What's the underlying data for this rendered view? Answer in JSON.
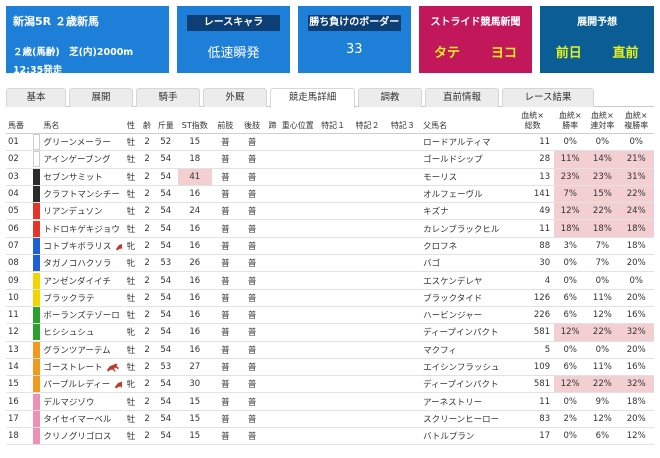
{
  "race": {
    "name": "新潟5R ２歳新馬",
    "cond": "２歳(馬齢)　芝(内)2000m",
    "time": "12:35発走"
  },
  "cards": {
    "chara": {
      "label": "レースキャラ",
      "value": "低速瞬発"
    },
    "border": {
      "label": "勝ち負けのボーダー",
      "value": "33"
    },
    "news": {
      "label": "ストライド競馬新聞",
      "left": "タテ",
      "right": "ヨコ"
    },
    "forecast": {
      "label": "展開予想",
      "left": "前日",
      "right": "直前"
    }
  },
  "tabs": [
    "基本",
    "展開",
    "騎手",
    "外厩",
    "競走馬詳細",
    "調教",
    "直前情報",
    "レース結果"
  ],
  "active_tab": 4,
  "columns": {
    "num": "馬番",
    "name": "馬名",
    "sex": "性",
    "age": "齢",
    "weight": "斤量",
    "st": "ST指数",
    "front": "前肢",
    "rear": "後肢",
    "hoof": "蹄",
    "center": "重心位置",
    "note1": "特記１",
    "note2": "特記２",
    "note3": "特記３",
    "sire": "父馬名",
    "runs": "血統×\n総数",
    "win": "血統×\n勝率",
    "quin": "血統×\n連対率",
    "show": "血統×\n複勝率"
  },
  "gate_colors": [
    "#ffffff",
    "#2b2b2b",
    "#e8332a",
    "#1f5fd6",
    "#f2d400",
    "#2ba12b",
    "#f39a1e",
    "#f08fb6"
  ],
  "rows": [
    {
      "num": "01",
      "gate": 0,
      "name": "グリーンメーラー",
      "mark": false,
      "sex": "牡",
      "age": "2",
      "weight": "52",
      "st": "15",
      "st_hl": false,
      "front": "普",
      "rear": "普",
      "sire": "ロードアルティマ",
      "runs": "11",
      "win": "0%",
      "quin": "0%",
      "show": "0%",
      "rate_hl": false
    },
    {
      "num": "02",
      "gate": 0,
      "name": "アインゲーブング",
      "mark": false,
      "sex": "牡",
      "age": "2",
      "weight": "54",
      "st": "18",
      "st_hl": false,
      "front": "普",
      "rear": "普",
      "sire": "ゴールドシップ",
      "runs": "28",
      "win": "11%",
      "quin": "14%",
      "show": "21%",
      "rate_hl": true
    },
    {
      "num": "03",
      "gate": 1,
      "name": "セブンサミット",
      "mark": false,
      "sex": "牡",
      "age": "2",
      "weight": "54",
      "st": "41",
      "st_hl": true,
      "front": "普",
      "rear": "普",
      "sire": "モーリス",
      "runs": "13",
      "win": "23%",
      "quin": "23%",
      "show": "31%",
      "rate_hl": true
    },
    {
      "num": "04",
      "gate": 1,
      "name": "クラフトマンシチー",
      "mark": false,
      "sex": "牡",
      "age": "2",
      "weight": "54",
      "st": "16",
      "st_hl": false,
      "front": "普",
      "rear": "普",
      "sire": "オルフェーヴル",
      "runs": "141",
      "win": "7%",
      "quin": "15%",
      "show": "22%",
      "rate_hl": true
    },
    {
      "num": "05",
      "gate": 2,
      "name": "リアンデュソン",
      "mark": false,
      "sex": "牡",
      "age": "2",
      "weight": "54",
      "st": "24",
      "st_hl": false,
      "front": "普",
      "rear": "普",
      "sire": "キズナ",
      "runs": "49",
      "win": "12%",
      "quin": "22%",
      "show": "24%",
      "rate_hl": true
    },
    {
      "num": "06",
      "gate": 2,
      "name": "トドロキゲキジョウ",
      "mark": false,
      "sex": "牡",
      "age": "2",
      "weight": "54",
      "st": "16",
      "st_hl": false,
      "front": "普",
      "rear": "普",
      "sire": "カレンブラックヒル",
      "runs": "11",
      "win": "18%",
      "quin": "18%",
      "show": "18%",
      "rate_hl": true
    },
    {
      "num": "07",
      "gate": 3,
      "name": "コトブキボラリス",
      "mark": true,
      "sex": "牝",
      "age": "2",
      "weight": "54",
      "st": "16",
      "st_hl": false,
      "front": "普",
      "rear": "普",
      "sire": "クロフネ",
      "runs": "88",
      "win": "3%",
      "quin": "7%",
      "show": "18%",
      "rate_hl": false
    },
    {
      "num": "08",
      "gate": 3,
      "name": "タガノコハクソラ",
      "mark": false,
      "sex": "牝",
      "age": "2",
      "weight": "53",
      "st": "26",
      "st_hl": false,
      "front": "普",
      "rear": "普",
      "sire": "バゴ",
      "runs": "30",
      "win": "0%",
      "quin": "7%",
      "show": "20%",
      "rate_hl": false
    },
    {
      "num": "09",
      "gate": 4,
      "name": "アンゼンダイイチ",
      "mark": false,
      "sex": "牡",
      "age": "2",
      "weight": "54",
      "st": "16",
      "st_hl": false,
      "front": "普",
      "rear": "普",
      "sire": "エスケンデレヤ",
      "runs": "4",
      "win": "0%",
      "quin": "0%",
      "show": "0%",
      "rate_hl": false
    },
    {
      "num": "10",
      "gate": 4,
      "name": "ブラックラテ",
      "mark": false,
      "sex": "牡",
      "age": "2",
      "weight": "54",
      "st": "16",
      "st_hl": false,
      "front": "普",
      "rear": "普",
      "sire": "ブラックタイド",
      "runs": "126",
      "win": "6%",
      "quin": "11%",
      "show": "20%",
      "rate_hl": false
    },
    {
      "num": "11",
      "gate": 5,
      "name": "ボーランズテゾーロ",
      "mark": false,
      "sex": "牡",
      "age": "2",
      "weight": "54",
      "st": "16",
      "st_hl": false,
      "front": "普",
      "rear": "普",
      "sire": "ハービンジャー",
      "runs": "226",
      "win": "6%",
      "quin": "12%",
      "show": "16%",
      "rate_hl": false
    },
    {
      "num": "12",
      "gate": 5,
      "name": "ヒシシュシュ",
      "mark": false,
      "sex": "牝",
      "age": "2",
      "weight": "54",
      "st": "16",
      "st_hl": false,
      "front": "普",
      "rear": "普",
      "sire": "ディープインパクト",
      "runs": "581",
      "win": "12%",
      "quin": "22%",
      "show": "32%",
      "rate_hl": true
    },
    {
      "num": "13",
      "gate": 6,
      "name": "グランツアーテム",
      "mark": false,
      "sex": "牡",
      "age": "2",
      "weight": "54",
      "st": "16",
      "st_hl": false,
      "front": "普",
      "rear": "普",
      "sire": "マクフィ",
      "runs": "5",
      "win": "0%",
      "quin": "0%",
      "show": "20%",
      "rate_hl": false
    },
    {
      "num": "14",
      "gate": 6,
      "name": "ゴーストレート",
      "mark": true,
      "sex": "牡",
      "age": "2",
      "weight": "53",
      "st": "27",
      "st_hl": false,
      "front": "普",
      "rear": "普",
      "sire": "エイシンフラッシュ",
      "runs": "109",
      "win": "6%",
      "quin": "11%",
      "show": "16%",
      "rate_hl": false
    },
    {
      "num": "15",
      "gate": 6,
      "name": "パープルレディー",
      "mark": true,
      "sex": "牝",
      "age": "2",
      "weight": "54",
      "st": "30",
      "st_hl": false,
      "front": "普",
      "rear": "普",
      "sire": "ディープインパクト",
      "runs": "581",
      "win": "12%",
      "quin": "22%",
      "show": "32%",
      "rate_hl": true
    },
    {
      "num": "16",
      "gate": 7,
      "name": "デルマジゾウ",
      "mark": false,
      "sex": "牡",
      "age": "2",
      "weight": "54",
      "st": "15",
      "st_hl": false,
      "front": "普",
      "rear": "普",
      "sire": "アーネストリー",
      "runs": "11",
      "win": "0%",
      "quin": "9%",
      "show": "18%",
      "rate_hl": false
    },
    {
      "num": "17",
      "gate": 7,
      "name": "タイセイマーベル",
      "mark": false,
      "sex": "牡",
      "age": "2",
      "weight": "54",
      "st": "15",
      "st_hl": false,
      "front": "普",
      "rear": "普",
      "sire": "スクリーンヒーロー",
      "runs": "83",
      "win": "2%",
      "quin": "12%",
      "show": "20%",
      "rate_hl": false
    },
    {
      "num": "18",
      "gate": 7,
      "name": "クリノグリゴロス",
      "mark": false,
      "sex": "牡",
      "age": "2",
      "weight": "54",
      "st": "15",
      "st_hl": false,
      "front": "普",
      "rear": "普",
      "sire": "バトルプラン",
      "runs": "17",
      "win": "0%",
      "quin": "6%",
      "show": "12%",
      "rate_hl": false
    }
  ]
}
